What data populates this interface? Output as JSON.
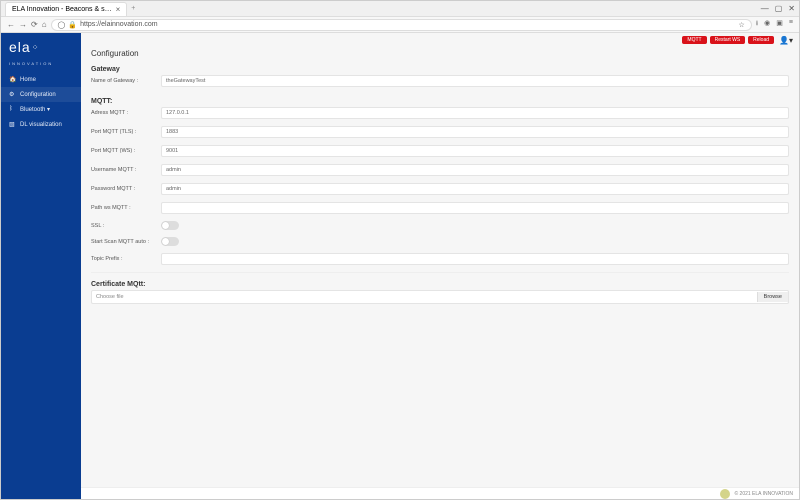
{
  "browser": {
    "tab_title": "ELA Innovation - Beacons & s…",
    "url": "https://elainnovation.com",
    "win_min": "—",
    "win_max": "▢",
    "win_close": "✕"
  },
  "logo": {
    "main": "ela",
    "sub": "INNOVATION"
  },
  "sidebar": {
    "items": [
      {
        "icon": "🏠",
        "label": "Home"
      },
      {
        "icon": "⚙",
        "label": "Configuration"
      },
      {
        "icon": "ᛒ",
        "label": "Bluetooth ▾"
      },
      {
        "icon": "▧",
        "label": "DL visualization"
      }
    ]
  },
  "topbar": {
    "btn1": "MQTT",
    "btn2": "Restart WS",
    "btn3": "Reload"
  },
  "page": {
    "title": "Configuration"
  },
  "gateway": {
    "heading": "Gateway",
    "name_label": "Name of Gateway :",
    "name_value": "theGatewayTest"
  },
  "mqtt": {
    "heading": "MQTT:",
    "address_label": "Adress MQTT :",
    "address_value": "127.0.0.1",
    "port_tls_label": "Port MQTT (TLS) :",
    "port_tls_value": "1883",
    "port_ws_label": "Port MQTT (WS) :",
    "port_ws_value": "9001",
    "user_label": "Username MQTT :",
    "user_value": "admin",
    "pass_label": "Password MQTT :",
    "pass_value": "admin",
    "pathws_label": "Path ws MQTT :",
    "pathws_value": "",
    "ssl_label": "SSL :",
    "autoscan_label": "Start Scan MQTT auto :",
    "topic_label": "Topic Prefix :",
    "topic_value": ""
  },
  "cert": {
    "heading": "Certificate MQtt:",
    "choose": "Choose file",
    "browse": "Browse"
  },
  "footer": {
    "copyright": "© 2021 ELA INNOVATION"
  }
}
